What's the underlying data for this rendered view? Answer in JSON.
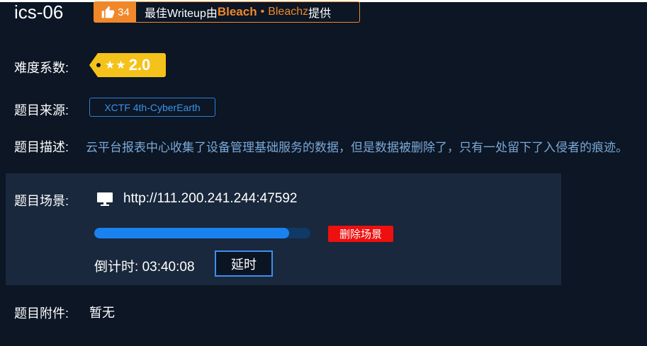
{
  "challenge": {
    "title": "ics-06"
  },
  "writeup": {
    "likes": "34",
    "prefix": "最佳Writeup由",
    "author": "Bleach",
    "separator": "•",
    "alias": "Bleachz",
    "suffix": "提供"
  },
  "difficulty": {
    "label": "难度系数:",
    "score": "2.0",
    "stars": "★★"
  },
  "source": {
    "label": "题目来源:",
    "value": "XCTF 4th-CyberEarth"
  },
  "description": {
    "label": "题目描述:",
    "text": "云平台报表中心收集了设备管理基础服务的数据，但是数据被删除了，只有一处留下了入侵者的痕迹。"
  },
  "scene": {
    "label": "题目场景:",
    "url": "http://111.200.241.244:47592",
    "progress_fraction": 0.9,
    "delete_label": "删除场景",
    "countdown_label": "倒计时:",
    "countdown_value": "03:40:08",
    "extend_label": "延时"
  },
  "attachment": {
    "label": "题目附件:",
    "value": "暂无"
  },
  "icons": [
    "thumbs-up-icon",
    "star-icon",
    "monitor-icon"
  ],
  "colors": {
    "accent_orange": "#f0882a",
    "accent_blue": "#1a82f0",
    "danger_red": "#ee0f0f",
    "difficulty_yellow": "#f4c21a",
    "background": "#0c1624"
  }
}
